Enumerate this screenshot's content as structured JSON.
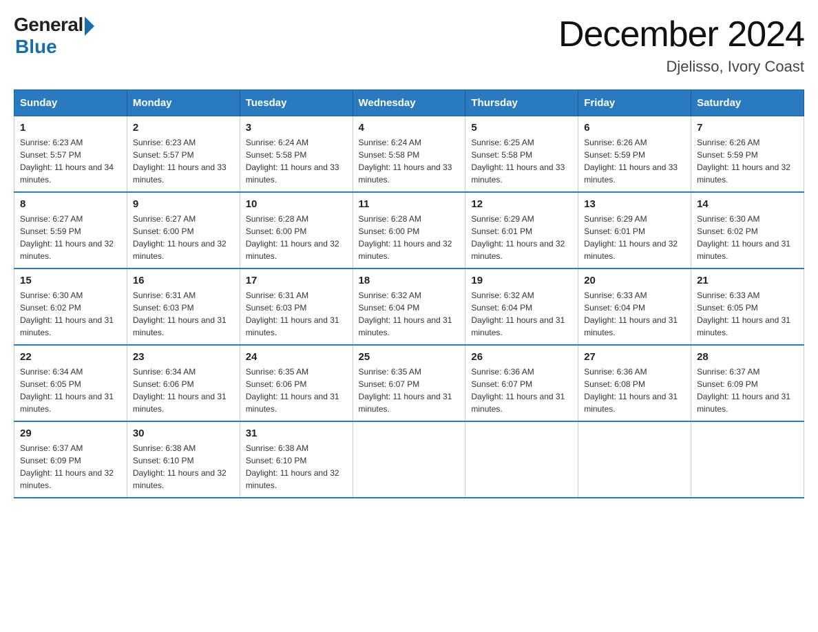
{
  "logo": {
    "general": "General",
    "arrow": "▶",
    "blue": "Blue"
  },
  "title": "December 2024",
  "location": "Djelisso, Ivory Coast",
  "days_of_week": [
    "Sunday",
    "Monday",
    "Tuesday",
    "Wednesday",
    "Thursday",
    "Friday",
    "Saturday"
  ],
  "weeks": [
    [
      {
        "day": "1",
        "sunrise": "6:23 AM",
        "sunset": "5:57 PM",
        "daylight": "11 hours and 34 minutes."
      },
      {
        "day": "2",
        "sunrise": "6:23 AM",
        "sunset": "5:57 PM",
        "daylight": "11 hours and 33 minutes."
      },
      {
        "day": "3",
        "sunrise": "6:24 AM",
        "sunset": "5:58 PM",
        "daylight": "11 hours and 33 minutes."
      },
      {
        "day": "4",
        "sunrise": "6:24 AM",
        "sunset": "5:58 PM",
        "daylight": "11 hours and 33 minutes."
      },
      {
        "day": "5",
        "sunrise": "6:25 AM",
        "sunset": "5:58 PM",
        "daylight": "11 hours and 33 minutes."
      },
      {
        "day": "6",
        "sunrise": "6:26 AM",
        "sunset": "5:59 PM",
        "daylight": "11 hours and 33 minutes."
      },
      {
        "day": "7",
        "sunrise": "6:26 AM",
        "sunset": "5:59 PM",
        "daylight": "11 hours and 32 minutes."
      }
    ],
    [
      {
        "day": "8",
        "sunrise": "6:27 AM",
        "sunset": "5:59 PM",
        "daylight": "11 hours and 32 minutes."
      },
      {
        "day": "9",
        "sunrise": "6:27 AM",
        "sunset": "6:00 PM",
        "daylight": "11 hours and 32 minutes."
      },
      {
        "day": "10",
        "sunrise": "6:28 AM",
        "sunset": "6:00 PM",
        "daylight": "11 hours and 32 minutes."
      },
      {
        "day": "11",
        "sunrise": "6:28 AM",
        "sunset": "6:00 PM",
        "daylight": "11 hours and 32 minutes."
      },
      {
        "day": "12",
        "sunrise": "6:29 AM",
        "sunset": "6:01 PM",
        "daylight": "11 hours and 32 minutes."
      },
      {
        "day": "13",
        "sunrise": "6:29 AM",
        "sunset": "6:01 PM",
        "daylight": "11 hours and 32 minutes."
      },
      {
        "day": "14",
        "sunrise": "6:30 AM",
        "sunset": "6:02 PM",
        "daylight": "11 hours and 31 minutes."
      }
    ],
    [
      {
        "day": "15",
        "sunrise": "6:30 AM",
        "sunset": "6:02 PM",
        "daylight": "11 hours and 31 minutes."
      },
      {
        "day": "16",
        "sunrise": "6:31 AM",
        "sunset": "6:03 PM",
        "daylight": "11 hours and 31 minutes."
      },
      {
        "day": "17",
        "sunrise": "6:31 AM",
        "sunset": "6:03 PM",
        "daylight": "11 hours and 31 minutes."
      },
      {
        "day": "18",
        "sunrise": "6:32 AM",
        "sunset": "6:04 PM",
        "daylight": "11 hours and 31 minutes."
      },
      {
        "day": "19",
        "sunrise": "6:32 AM",
        "sunset": "6:04 PM",
        "daylight": "11 hours and 31 minutes."
      },
      {
        "day": "20",
        "sunrise": "6:33 AM",
        "sunset": "6:04 PM",
        "daylight": "11 hours and 31 minutes."
      },
      {
        "day": "21",
        "sunrise": "6:33 AM",
        "sunset": "6:05 PM",
        "daylight": "11 hours and 31 minutes."
      }
    ],
    [
      {
        "day": "22",
        "sunrise": "6:34 AM",
        "sunset": "6:05 PM",
        "daylight": "11 hours and 31 minutes."
      },
      {
        "day": "23",
        "sunrise": "6:34 AM",
        "sunset": "6:06 PM",
        "daylight": "11 hours and 31 minutes."
      },
      {
        "day": "24",
        "sunrise": "6:35 AM",
        "sunset": "6:06 PM",
        "daylight": "11 hours and 31 minutes."
      },
      {
        "day": "25",
        "sunrise": "6:35 AM",
        "sunset": "6:07 PM",
        "daylight": "11 hours and 31 minutes."
      },
      {
        "day": "26",
        "sunrise": "6:36 AM",
        "sunset": "6:07 PM",
        "daylight": "11 hours and 31 minutes."
      },
      {
        "day": "27",
        "sunrise": "6:36 AM",
        "sunset": "6:08 PM",
        "daylight": "11 hours and 31 minutes."
      },
      {
        "day": "28",
        "sunrise": "6:37 AM",
        "sunset": "6:09 PM",
        "daylight": "11 hours and 31 minutes."
      }
    ],
    [
      {
        "day": "29",
        "sunrise": "6:37 AM",
        "sunset": "6:09 PM",
        "daylight": "11 hours and 32 minutes."
      },
      {
        "day": "30",
        "sunrise": "6:38 AM",
        "sunset": "6:10 PM",
        "daylight": "11 hours and 32 minutes."
      },
      {
        "day": "31",
        "sunrise": "6:38 AM",
        "sunset": "6:10 PM",
        "daylight": "11 hours and 32 minutes."
      },
      null,
      null,
      null,
      null
    ]
  ]
}
